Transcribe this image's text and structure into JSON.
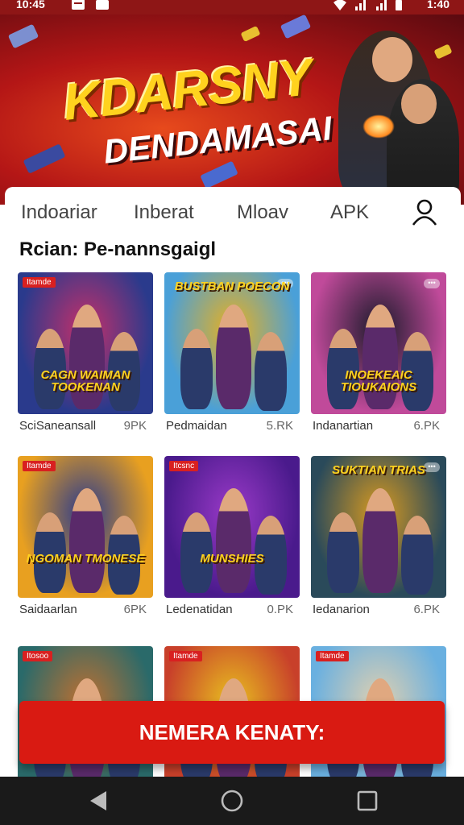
{
  "status_bar": {
    "time": "10:45",
    "right_time": "1:40"
  },
  "banner": {
    "title_line1": "KDARSNY",
    "title_line2": "DENDAMASAI"
  },
  "tabs": [
    {
      "label": "Indoariar"
    },
    {
      "label": "Inberat"
    },
    {
      "label": "Mloav"
    },
    {
      "label": "APK"
    }
  ],
  "section_title": "Rcian: Pe-nannsgaigl",
  "apps": [
    {
      "name": "SciSaneansall",
      "size": "9PK",
      "badge": "Itamde",
      "art_title": "CAGN WAIMAN TOOKENAN",
      "bg": "#2a3a8c",
      "accent": "#c4306a"
    },
    {
      "name": "Pedmaidan",
      "size": "5.RK",
      "badge": "",
      "art_title": "BUSTBAN POECON",
      "bg": "#4aa0d8",
      "accent": "#e8b020"
    },
    {
      "name": "Indanartian",
      "size": "6.PK",
      "badge": "",
      "art_title": "INOEKEAIC TIOUKAIONS",
      "bg": "#c04a9a",
      "accent": "#1a1a2a"
    },
    {
      "name": "Saidaarlan",
      "size": "6PK",
      "badge": "Itamde",
      "art_title": "NGOMAN TMONESE",
      "bg": "#e8a020",
      "accent": "#2a3a8c"
    },
    {
      "name": "Ledenatidan",
      "size": "0.PK",
      "badge": "Itcsnc",
      "art_title": "MUNSHIES",
      "bg": "#4a1a8c",
      "accent": "#9a3ac8"
    },
    {
      "name": "Iedanarion",
      "size": "6.PK",
      "badge": "",
      "art_title": "SUKTIAN TRIAS",
      "bg": "#2a4a5a",
      "accent": "#d89a20"
    },
    {
      "name": "",
      "size": "",
      "badge": "Itosoo",
      "art_title": "",
      "bg": "#2a6a6a",
      "accent": "#c07030"
    },
    {
      "name": "",
      "size": "",
      "badge": "Itamde",
      "art_title": "",
      "bg": "#c8402a",
      "accent": "#e8c020"
    },
    {
      "name": "",
      "size": "",
      "badge": "Itamde",
      "art_title": "",
      "bg": "#6ab0e0",
      "accent": "#e0d0b0"
    }
  ],
  "cta": {
    "label": "NEMERA KENATY:"
  },
  "icons": {
    "user": "user-icon",
    "nav_back": "triangle-back-icon",
    "nav_home": "circle-home-icon",
    "nav_recent": "square-recent-icon"
  },
  "colors": {
    "primary_red": "#d91a12",
    "banner_red": "#b41616",
    "nav_bg": "#1a1a1a"
  }
}
